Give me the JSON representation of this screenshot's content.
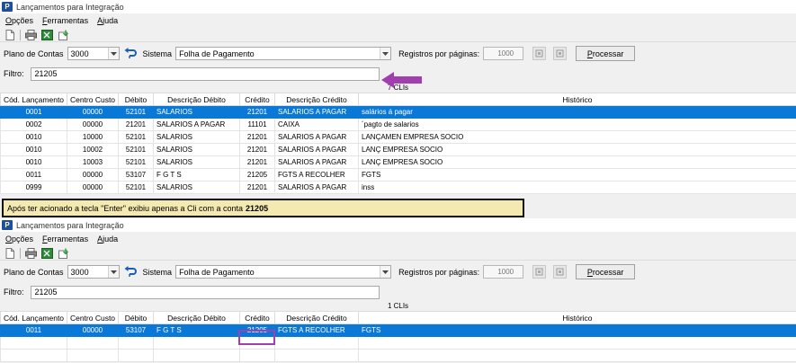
{
  "window_title": "Lançamentos para Integração",
  "menu": [
    {
      "label": "Opções",
      "u": "O",
      "rest": "pções"
    },
    {
      "label": "Ferramentas",
      "u": "F",
      "rest": "erramentas"
    },
    {
      "label": "Ajuda",
      "u": "A",
      "rest": "juda"
    }
  ],
  "params": {
    "plano_label": "Plano de Contas",
    "plano_value": "3000",
    "sistema_label": "Sistema",
    "sistema_value": "Folha de Pagamento",
    "registros_label": "Registros por páginas:",
    "registros_value": "1000",
    "processar_u": "P",
    "processar_rest": "rocessar"
  },
  "filter": {
    "label": "Filtro:",
    "value": "21205"
  },
  "columns": [
    "Cód. Lançamento",
    "Centro Custo",
    "Débito",
    "Descrição Débito",
    "Crédito",
    "Descrição Crédito",
    "Histórico"
  ],
  "top": {
    "count": "7 CLIs",
    "rows": [
      [
        "0001",
        "00000",
        "52101",
        "SALARIOS",
        "21201",
        "SALARIOS A PAGAR",
        "salários á pagar"
      ],
      [
        "0002",
        "00000",
        "21201",
        "SALARIOS A PAGAR",
        "11101",
        "CAIXA",
        "´pagto de salarios"
      ],
      [
        "0010",
        "10000",
        "52101",
        "SALARIOS",
        "21201",
        "SALARIOS A PAGAR",
        "LANÇAMEN EMPRESA SOCIO"
      ],
      [
        "0010",
        "10002",
        "52101",
        "SALARIOS",
        "21201",
        "SALARIOS A PAGAR",
        "LANÇ EMPRESA SOCIO"
      ],
      [
        "0010",
        "10003",
        "52101",
        "SALARIOS",
        "21201",
        "SALARIOS A PAGAR",
        "LANÇ EMPRESA SOCIO"
      ],
      [
        "0011",
        "00000",
        "53107",
        "F G T S",
        "21205",
        "FGTS A RECOLHER",
        "FGTS"
      ],
      [
        "0999",
        "00000",
        "52101",
        "SALARIOS",
        "21201",
        "SALARIOS A PAGAR",
        "inss"
      ]
    ]
  },
  "annotation": {
    "text": "Após ter acionado a tecla \"Enter\" exibiu apenas a Cli com a conta",
    "bold": "21205"
  },
  "bottom": {
    "count": "1 CLIs",
    "rows": [
      [
        "0011",
        "00000",
        "53107",
        "F G T S",
        "21205",
        "FGTS A RECOLHER",
        "FGTS"
      ]
    ]
  },
  "colors": {
    "selection": "#0a78d7",
    "annotation_bg": "#f5e9b2",
    "accent_purple": "#a23fb0"
  },
  "icons": [
    "new-document-icon",
    "print-icon",
    "export-excel-icon",
    "import-icon",
    "refresh-icon",
    "first-page-icon",
    "last-page-icon",
    "dropdown-arrow-icon"
  ]
}
